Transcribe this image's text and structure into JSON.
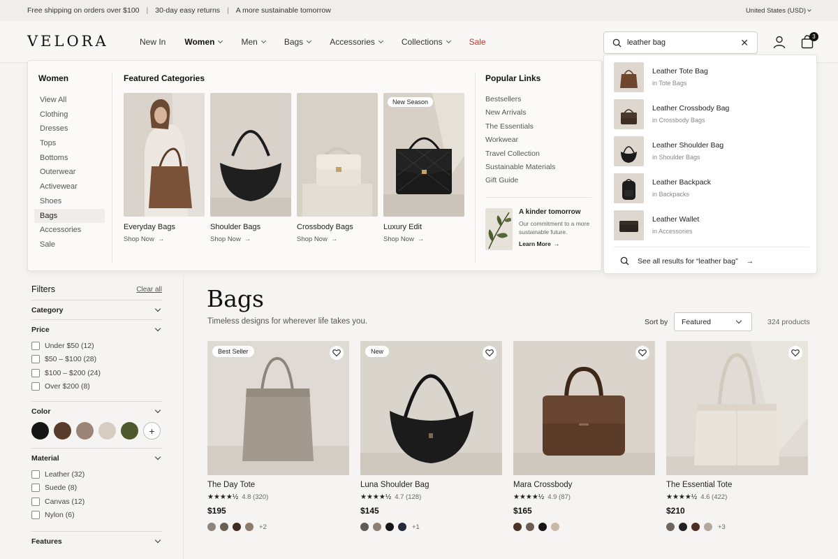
{
  "announcement": {
    "messages": [
      "Free shipping on orders over $100",
      "30-day easy returns",
      "A more sustainable tomorrow"
    ],
    "region": "United States (USD)"
  },
  "header": {
    "logo": "VELORA",
    "nav": [
      "New In",
      "Women",
      "Men",
      "Bags",
      "Accessories",
      "Collections",
      "Sale"
    ],
    "search_value": "leather bag",
    "cart_count": "3"
  },
  "mega": {
    "women_title": "Women",
    "women_items": [
      "View All",
      "Clothing",
      "Dresses",
      "Tops",
      "Bottoms",
      "Outerwear",
      "Activewear",
      "Shoes",
      "Bags",
      "Accessories",
      "Sale"
    ],
    "featured_title": "Featured Categories",
    "featured": [
      {
        "name": "Everyday Bags",
        "cta": "Shop Now",
        "tag": ""
      },
      {
        "name": "Shoulder Bags",
        "cta": "Shop Now",
        "tag": ""
      },
      {
        "name": "Crossbody Bags",
        "cta": "Shop Now",
        "tag": ""
      },
      {
        "name": "Luxury Edit",
        "cta": "Shop Now",
        "tag": "New Season"
      }
    ],
    "popular_title": "Popular Links",
    "popular": [
      "Bestsellers",
      "New Arrivals",
      "The Essentials",
      "Workwear",
      "Travel Collection",
      "Sustainable Materials",
      "Gift Guide"
    ],
    "promo": {
      "title": "A kinder tomorrow",
      "desc": "Our commitment to a more sustainable future.",
      "link": "Learn More"
    }
  },
  "suggestions": {
    "items": [
      {
        "title": "Leather Tote Bag",
        "sub": "in Tote Bags"
      },
      {
        "title": "Leather Crossbody Bag",
        "sub": "in Crossbody Bags"
      },
      {
        "title": "Leather Shoulder Bag",
        "sub": "in Shoulder Bags"
      },
      {
        "title": "Leather Backpack",
        "sub": "in Backpacks"
      },
      {
        "title": "Leather Wallet",
        "sub": "in Accessories"
      }
    ],
    "see_all": "See all results for “leather bag”"
  },
  "filters": {
    "title": "Filters",
    "clear": "Clear all",
    "category": "Category",
    "price": "Price",
    "price_options": [
      "Under $50 (12)",
      "$50 – $100 (28)",
      "$100 – $200 (24)",
      "Over $200 (8)"
    ],
    "color": "Color",
    "color_swatches": [
      "#151515",
      "#5a3a2a",
      "#9a8577",
      "#d6ccc2",
      "#4e5a2c"
    ],
    "material": "Material",
    "material_options": [
      "Leather (32)",
      "Suede (8)",
      "Canvas (12)",
      "Nylon (6)"
    ],
    "features": "Features"
  },
  "main": {
    "title": "Bags",
    "subtitle": "Timeless designs for wherever life takes you.",
    "sort_label": "Sort by",
    "sort_value": "Featured",
    "count": "324 products"
  },
  "products": [
    {
      "name": "The Day Tote",
      "tag": "Best Seller",
      "rating": "4.8 (320)",
      "price": "$195",
      "colors": [
        "#8d857d",
        "#6a5f57",
        "#3d2a22",
        "#8c7a6b"
      ],
      "more": "+2"
    },
    {
      "name": "Luna Shoulder Bag",
      "tag": "New",
      "rating": "4.7 (128)",
      "price": "$145",
      "colors": [
        "#5f5a55",
        "#8a7e72",
        "#161616",
        "#252a3a"
      ],
      "more": "+1"
    },
    {
      "name": "Mara Crossbody",
      "tag": "",
      "rating": "4.9 (87)",
      "price": "$165",
      "colors": [
        "#4b3325",
        "#6a5d52",
        "#161616",
        "#c8b8a8"
      ],
      "more": ""
    },
    {
      "name": "The Essential Tote",
      "tag": "",
      "rating": "4.6 (422)",
      "price": "$210",
      "colors": [
        "#6d6660",
        "#222222",
        "#4a3022",
        "#b2a89c"
      ],
      "more": "+3"
    }
  ]
}
